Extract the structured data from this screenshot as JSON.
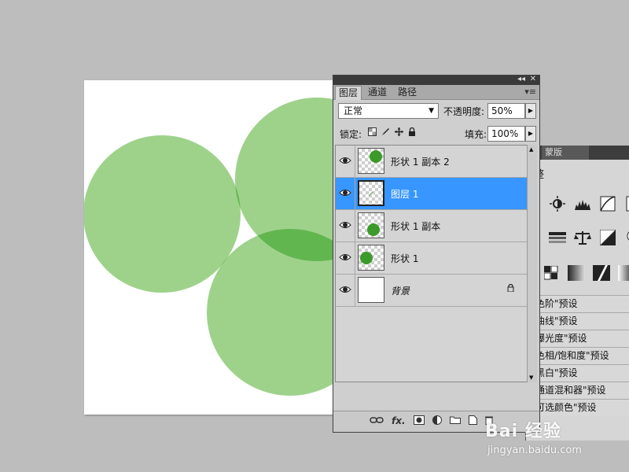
{
  "canvas": {
    "circle_color": "#9ed28b",
    "overlap_color": "#62b64f",
    "triple_overlap_color": "#4aa437"
  },
  "layers_panel": {
    "tabs": [
      "图层",
      "通道",
      "路径"
    ],
    "blend_mode": "正常",
    "opacity_label": "不透明度:",
    "opacity_value": "50%",
    "lock_label": "锁定:",
    "fill_label": "填充:",
    "fill_value": "100%",
    "layers": [
      {
        "name": "形状 1 副本 2",
        "selected": false,
        "thumb": "green-dot-top-right"
      },
      {
        "name": "图层 1",
        "selected": true,
        "thumb": "empty"
      },
      {
        "name": "形状 1 副本",
        "selected": false,
        "thumb": "green-dot-bottom"
      },
      {
        "name": "形状 1",
        "selected": false,
        "thumb": "green-dot-left"
      },
      {
        "name": "背景",
        "selected": false,
        "thumb": "white",
        "locked": true
      }
    ],
    "bottom_icons": [
      "link-icon",
      "fx-icon",
      "mask-icon",
      "adjustment-icon",
      "group-icon",
      "new-layer-icon",
      "trash-icon"
    ],
    "fx_label": "fx."
  },
  "adjustments_panel": {
    "tab_label": "蒙版",
    "title": "整",
    "presets": [
      "色阶\"预设",
      "曲线\"预设",
      "曝光度\"预设",
      "色相/饱和度\"预设",
      "黑白\"预设",
      "通道混和器\"预设",
      "可选颜色\"预设"
    ]
  },
  "watermark": {
    "brand": "Bai 经验",
    "url": "jingyan.baidu.com"
  },
  "accent_color": "#3796ff"
}
